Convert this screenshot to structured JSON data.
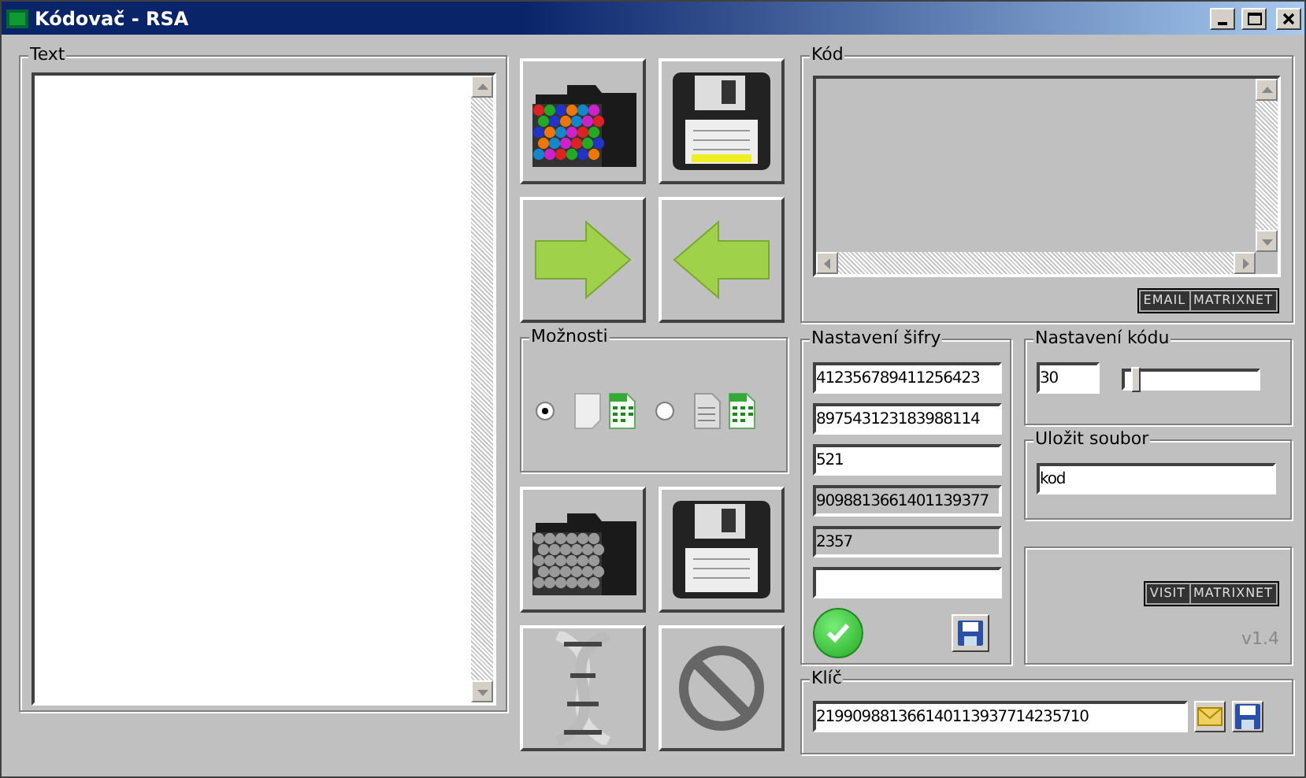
{
  "window": {
    "title": "Kódovač - RSA"
  },
  "text_panel": {
    "label": "Text"
  },
  "options": {
    "label": "Možnosti",
    "choices": [
      {
        "selected": true
      },
      {
        "selected": false
      }
    ]
  },
  "code_panel": {
    "label": "Kód",
    "badge": [
      "EMAIL",
      "MATRIXNET"
    ]
  },
  "cipher_settings": {
    "label": "Nastavení šifry",
    "fields": [
      {
        "value": "412356789411256423",
        "disabled": false
      },
      {
        "value": "897543123183988114",
        "disabled": false
      },
      {
        "value": "521",
        "disabled": false
      },
      {
        "value": "9098813661401139377",
        "disabled": true
      },
      {
        "value": "2357",
        "disabled": true
      },
      {
        "disabled": false
      }
    ]
  },
  "code_settings": {
    "label": "Nastavení kódu",
    "value": "30",
    "slider": {
      "level": 0.05
    }
  },
  "save_file": {
    "label": "Uložit soubor",
    "value": "kod"
  },
  "info": {
    "badge": [
      "VISIT",
      "MATRIXNET"
    ],
    "version": "v1.4"
  },
  "key": {
    "label": "Klíč",
    "value": "219909881366140113937714235710"
  }
}
